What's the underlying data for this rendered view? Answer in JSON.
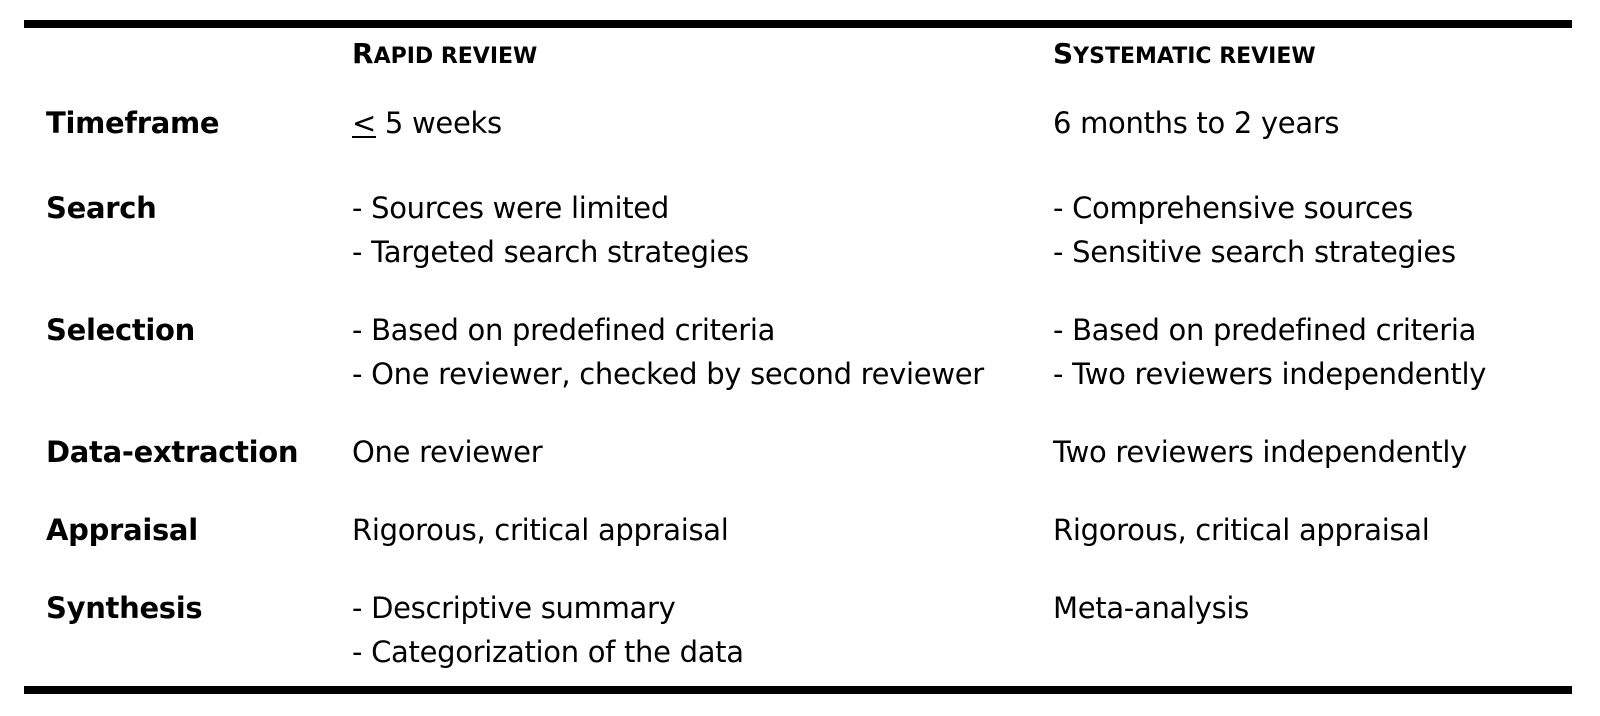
{
  "table": {
    "headers": {
      "rapid": {
        "initial": "R",
        "rest": "APID REVIEW"
      },
      "systematic": {
        "initial": "S",
        "rest": "YSTEMATIC REVIEW"
      }
    },
    "rows": [
      {
        "label": "Timeframe",
        "rapid": [
          "≤ 5 weeks"
        ],
        "rapid_symbol": "<",
        "rapid_rest": " 5 weeks",
        "systematic": [
          "6 months to 2 years"
        ]
      },
      {
        "label": "Search",
        "rapid": [
          "- Sources were limited",
          "- Targeted search strategies"
        ],
        "systematic": [
          "- Comprehensive sources",
          "- Sensitive search strategies"
        ]
      },
      {
        "label": "Selection",
        "rapid": [
          "- Based on predefined criteria",
          "- One reviewer, checked by second reviewer"
        ],
        "systematic": [
          "- Based on predefined criteria",
          "- Two reviewers independently"
        ]
      },
      {
        "label": "Data-extraction",
        "rapid": [
          "One reviewer"
        ],
        "systematic": [
          "Two reviewers independently"
        ]
      },
      {
        "label": "Appraisal",
        "rapid": [
          "Rigorous, critical appraisal"
        ],
        "systematic": [
          "Rigorous, critical appraisal"
        ]
      },
      {
        "label": "Synthesis",
        "rapid": [
          "- Descriptive summary",
          "- Categorization of the data"
        ],
        "systematic": [
          "Meta-analysis"
        ]
      }
    ]
  }
}
